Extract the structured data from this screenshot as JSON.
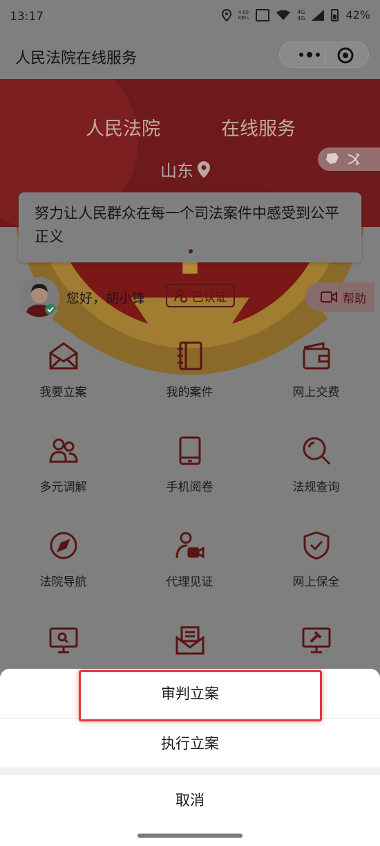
{
  "status_bar": {
    "time": "13:17",
    "net_speed": "4.69",
    "net_unit": "KB/s",
    "net_type_1": "4G",
    "net_type_2": "4G",
    "battery": "42%"
  },
  "navbar": {
    "title": "人民法院在线服务",
    "more_icon": "more-dots-icon",
    "close_icon": "target-circle-icon"
  },
  "banner": {
    "title_left": "人民法院",
    "title_right": "在线服务",
    "region": "山东",
    "emblem_icon": "court-emblem-icon",
    "location_icon": "location-pin-icon",
    "switch_icon": "map-shuffle-icon"
  },
  "notice": {
    "text": "努力让人民群众在每一个司法案件中感受到公平正义"
  },
  "user": {
    "greeting": "您好，胡小锋",
    "verified_label": "已认证",
    "help_label": "帮助"
  },
  "services": [
    {
      "label": "我要立案",
      "icon": "envelope-open-icon"
    },
    {
      "label": "我的案件",
      "icon": "notebook-icon"
    },
    {
      "label": "网上交费",
      "icon": "wallet-icon"
    },
    {
      "label": "多元调解",
      "icon": "people-icon"
    },
    {
      "label": "手机阅卷",
      "icon": "tablet-icon"
    },
    {
      "label": "法规查询",
      "icon": "search-icon"
    },
    {
      "label": "法院导航",
      "icon": "compass-icon"
    },
    {
      "label": "代理见证",
      "icon": "user-video-icon"
    },
    {
      "label": "网上保全",
      "icon": "shield-check-icon"
    },
    {
      "label": "",
      "icon": "monitor-search-icon"
    },
    {
      "label": "",
      "icon": "mail-document-icon"
    },
    {
      "label": "",
      "icon": "gavel-screen-icon"
    }
  ],
  "action_sheet": {
    "option_1": "审判立案",
    "option_2": "执行立案",
    "cancel": "取消"
  },
  "colors": {
    "brand_red": "#6c1a1b",
    "icon_red": "#5a1414",
    "highlight": "#e0383a"
  }
}
